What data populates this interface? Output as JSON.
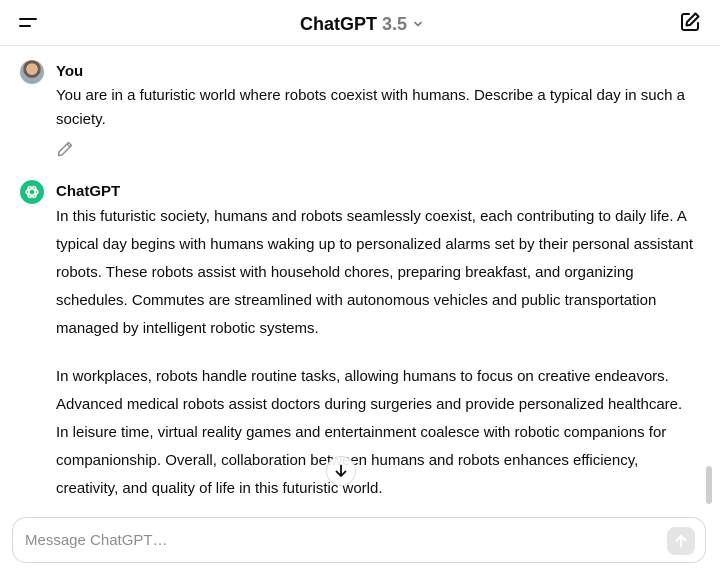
{
  "header": {
    "model_name": "ChatGPT",
    "model_version": "3.5",
    "menu_icon": "menu-icon",
    "new_chat_icon": "new-chat-icon"
  },
  "conversation": {
    "user_message": {
      "author": "You",
      "text": "You are in a futuristic world where robots coexist with humans. Describe a typical day in such a society."
    },
    "assistant_message": {
      "author": "ChatGPT",
      "paragraphs": [
        "In this futuristic society, humans and robots seamlessly coexist, each contributing to daily life. A typical day begins with humans waking up to personalized alarms set by their personal assistant robots. These robots assist with household chores, preparing breakfast, and organizing schedules. Commutes are streamlined with autonomous vehicles and public transportation managed by intelligent robotic systems.",
        "In workplaces, robots handle routine tasks, allowing humans to focus on creative endeavors. Advanced medical robots assist doctors during surgeries and provide personalized healthcare. In leisure time, virtual reality games and entertainment coalesce with robotic companions for companionship. Overall, collaboration between humans and robots enhances efficiency, creativity, and quality of life in this futuristic world."
      ]
    }
  },
  "composer": {
    "placeholder": "Message ChatGPT…",
    "value": ""
  },
  "colors": {
    "accent": "#19c37d",
    "text": "#0d0d0d",
    "muted": "#7b7b7b",
    "border": "#e5e5e5"
  }
}
